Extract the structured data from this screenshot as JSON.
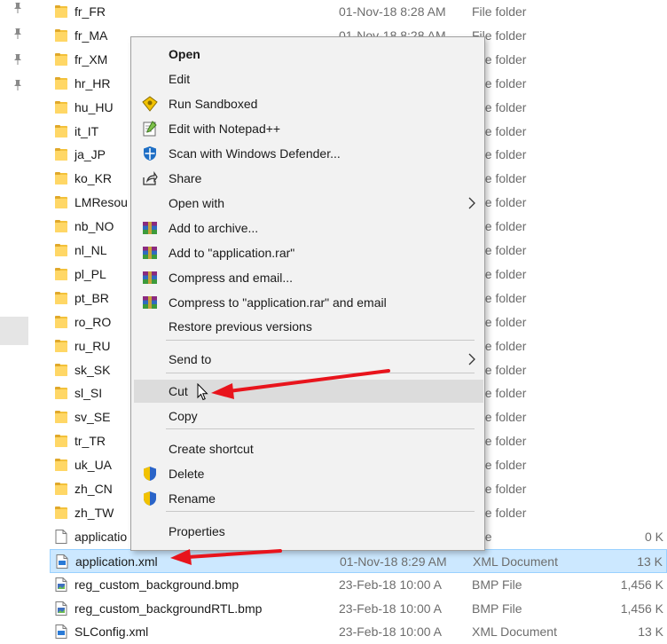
{
  "nav": {
    "pins": [
      "pin-icon",
      "pin-icon",
      "pin-icon",
      "pin-icon"
    ]
  },
  "files": [
    {
      "name": "fr_FR",
      "date": "01-Nov-18 8:28 AM",
      "type": "File folder",
      "size": "",
      "icon": "folder-icon"
    },
    {
      "name": "fr_MA",
      "date": "01-Nov-18 8:28 AM",
      "type": "File folder",
      "size": "",
      "icon": "folder-icon"
    },
    {
      "name": "fr_XM",
      "date": "",
      "type": "File folder",
      "size": "",
      "icon": "folder-icon"
    },
    {
      "name": "hr_HR",
      "date": "",
      "type": "File folder",
      "size": "",
      "icon": "folder-icon"
    },
    {
      "name": "hu_HU",
      "date": "",
      "type": "File folder",
      "size": "",
      "icon": "folder-icon"
    },
    {
      "name": "it_IT",
      "date": "",
      "type": "File folder",
      "size": "",
      "icon": "folder-icon"
    },
    {
      "name": "ja_JP",
      "date": "",
      "type": "File folder",
      "size": "",
      "icon": "folder-icon"
    },
    {
      "name": "ko_KR",
      "date": "",
      "type": "File folder",
      "size": "",
      "icon": "folder-icon"
    },
    {
      "name": "LMResou",
      "date": "",
      "type": "File folder",
      "size": "",
      "icon": "folder-icon"
    },
    {
      "name": "nb_NO",
      "date": "",
      "type": "File folder",
      "size": "",
      "icon": "folder-icon"
    },
    {
      "name": "nl_NL",
      "date": "",
      "type": "File folder",
      "size": "",
      "icon": "folder-icon"
    },
    {
      "name": "pl_PL",
      "date": "",
      "type": "File folder",
      "size": "",
      "icon": "folder-icon"
    },
    {
      "name": "pt_BR",
      "date": "",
      "type": "File folder",
      "size": "",
      "icon": "folder-icon"
    },
    {
      "name": "ro_RO",
      "date": "",
      "type": "File folder",
      "size": "",
      "icon": "folder-icon"
    },
    {
      "name": "ru_RU",
      "date": "",
      "type": "File folder",
      "size": "",
      "icon": "folder-icon"
    },
    {
      "name": "sk_SK",
      "date": "",
      "type": "File folder",
      "size": "",
      "icon": "folder-icon"
    },
    {
      "name": "sl_SI",
      "date": "",
      "type": "File folder",
      "size": "",
      "icon": "folder-icon"
    },
    {
      "name": "sv_SE",
      "date": "",
      "type": "File folder",
      "size": "",
      "icon": "folder-icon"
    },
    {
      "name": "tr_TR",
      "date": "",
      "type": "File folder",
      "size": "",
      "icon": "folder-icon"
    },
    {
      "name": "uk_UA",
      "date": "",
      "type": "File folder",
      "size": "",
      "icon": "folder-icon"
    },
    {
      "name": "zh_CN",
      "date": "",
      "type": "File folder",
      "size": "",
      "icon": "folder-icon"
    },
    {
      "name": "zh_TW",
      "date": "",
      "type": "File folder",
      "size": "",
      "icon": "folder-icon"
    },
    {
      "name": "applicatio",
      "date": "",
      "type": "File",
      "size": "0 K",
      "icon": "file-icon"
    },
    {
      "name": "application.xml",
      "date": "01-Nov-18 8:29 AM",
      "type": "XML Document",
      "size": "13 K",
      "icon": "xml-file-icon"
    },
    {
      "name": "reg_custom_background.bmp",
      "date": "23-Feb-18 10:00 A",
      "type": "BMP File",
      "size": "1,456 K",
      "icon": "bmp-file-icon"
    },
    {
      "name": "reg_custom_backgroundRTL.bmp",
      "date": "23-Feb-18 10:00 A",
      "type": "BMP File",
      "size": "1,456 K",
      "icon": "bmp-file-icon"
    },
    {
      "name": "SLConfig.xml",
      "date": "23-Feb-18 10:00 A",
      "type": "XML Document",
      "size": "13 K",
      "icon": "xml-file-icon"
    }
  ],
  "context_menu": {
    "items": [
      {
        "label": "Open",
        "icon": "",
        "bold": true
      },
      {
        "label": "Edit",
        "icon": ""
      },
      {
        "label": "Run Sandboxed",
        "icon": "sandboxie-icon"
      },
      {
        "label": "Edit with Notepad++",
        "icon": "notepad-plus-plus-icon"
      },
      {
        "label": "Scan with Windows Defender...",
        "icon": "windows-defender-icon"
      },
      {
        "label": "Share",
        "icon": "share-icon"
      },
      {
        "label": "Open with",
        "icon": "",
        "submenu": true
      },
      {
        "label": "Add to archive...",
        "icon": "winrar-icon"
      },
      {
        "label": "Add to \"application.rar\"",
        "icon": "winrar-icon"
      },
      {
        "label": "Compress and email...",
        "icon": "winrar-icon"
      },
      {
        "label": "Compress to \"application.rar\" and email",
        "icon": "winrar-icon"
      },
      {
        "label": "Restore previous versions",
        "icon": ""
      },
      {
        "label": "Send to",
        "icon": "",
        "submenu": true
      },
      {
        "label": "Cut",
        "icon": "",
        "highlighted": true
      },
      {
        "label": "Copy",
        "icon": ""
      },
      {
        "label": "Create shortcut",
        "icon": ""
      },
      {
        "label": "Delete",
        "icon": "uac-shield-icon"
      },
      {
        "label": "Rename",
        "icon": "uac-shield-icon"
      },
      {
        "label": "Properties",
        "icon": ""
      }
    ]
  },
  "colors": {
    "selection_bg": "#cce8ff",
    "menu_bg": "#f2f2f2",
    "menu_highlight": "#dcdcdc",
    "annotation_red": "#e8141c",
    "folder_yellow": "#f3c13a"
  }
}
